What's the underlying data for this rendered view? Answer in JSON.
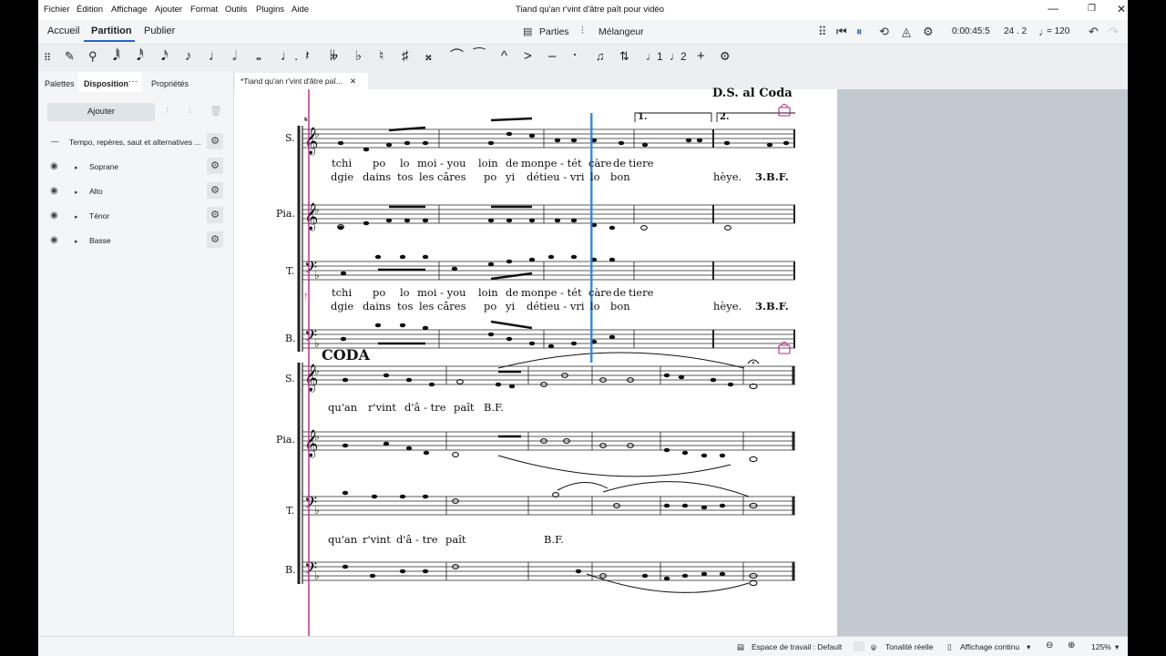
{
  "menu": [
    "Fichier",
    "Édition",
    "Affichage",
    "Ajouter",
    "Format",
    "Outils",
    "Plugins",
    "Aide"
  ],
  "window_title": "Tiand qu'an r'vint d'âtre paît pour vidéo",
  "window_controls": {
    "minimize": "—",
    "restore": "❐",
    "close": "✕"
  },
  "top_tabs": [
    "Accueil",
    "Partition",
    "Publier"
  ],
  "toolbar": {
    "parts_label": "Parties",
    "mixer_label": "Mélangeur",
    "time": "0:00:45:5",
    "position": "24 . 2",
    "tempo": "= 120"
  },
  "note_input_buttons": [
    "𝅘𝅥𝅱",
    "𝅘𝅥𝅰",
    "𝅘𝅥𝅯",
    "♪",
    "♩",
    "𝅗𝅥",
    "𝅝",
    "♩.",
    "𝄽",
    "𝄫",
    "♭",
    "♮",
    "♯",
    "𝄪",
    "⌒",
    "⁀",
    "^",
    ">",
    "–",
    "·"
  ],
  "panel": {
    "tabs": [
      "Palettes",
      "Disposition",
      "Propriétés"
    ],
    "more": "···",
    "add_button": "Ajouter",
    "rows": [
      {
        "label": "Tempo, repères, saut et alternatives ..."
      },
      {
        "label": "Soprane"
      },
      {
        "label": "Alto"
      },
      {
        "label": "Ténor"
      },
      {
        "label": "Basse"
      }
    ]
  },
  "document_tab": "*Tiand qu'an r'vint d'âtre paî...",
  "score": {
    "ds_al_coda": "D.S. al Coda",
    "volta1": "1.",
    "volta2": "2.",
    "coda": "CODA",
    "system1_staves": [
      "S.",
      "Pia.",
      "T.",
      "B."
    ],
    "system2_staves": [
      "S.",
      "Pia.",
      "T.",
      "B."
    ],
    "lyrics_s_line1": [
      "tchi",
      "po",
      "lo",
      "moi - you",
      "loin",
      "de",
      "monpe - tét",
      "càre",
      "de",
      "tiere"
    ],
    "lyrics_s_line2": [
      "dgie",
      "dains",
      "tos",
      "les",
      "câres",
      "po",
      "yi",
      "détieu - vri",
      "lo",
      "bon",
      "hèye.",
      "3.B.F."
    ],
    "lyrics_t_line1": [
      "tchi",
      "po",
      "lo",
      "moi - you",
      "loin",
      "de",
      "monpe - tét",
      "càre",
      "de",
      "tiere"
    ],
    "lyrics_t_line2": [
      "dgie",
      "dains",
      "tos",
      "les",
      "câres",
      "po",
      "yi",
      "détieu - vri",
      "lo",
      "bon",
      "hèye.",
      "3.B.F."
    ],
    "coda_s_lyrics": [
      "qu'an",
      "r'vint",
      "d'â - tre",
      "paît",
      "B.F."
    ],
    "coda_t_lyrics": [
      "qu'an",
      "r'vint",
      "d'â - tre",
      "paît",
      "B.F."
    ]
  },
  "statusbar": {
    "workspace": "Espace de travail : Default",
    "concert_pitch": "Tonalité réelle",
    "view_mode": "Affichage continu",
    "zoom": "125%"
  }
}
